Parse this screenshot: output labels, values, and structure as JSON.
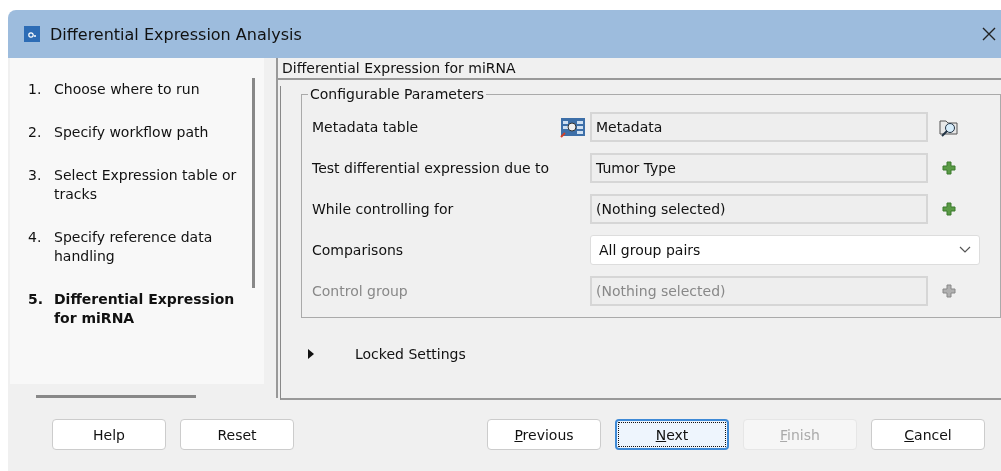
{
  "window": {
    "title": "Differential Expression Analysis"
  },
  "steps": [
    {
      "number": "1.",
      "label": "Choose where to run",
      "selected": false
    },
    {
      "number": "2.",
      "label": "Specify workflow path",
      "selected": false
    },
    {
      "number": "3.",
      "label": "Select Expression table or tracks",
      "selected": false
    },
    {
      "number": "4.",
      "label": "Specify reference data handling",
      "selected": false
    },
    {
      "number": "5.",
      "label": "Differential Expression for miRNA",
      "selected": true
    }
  ],
  "panel": {
    "title": "Differential Expression for miRNA",
    "group_title": "Configurable Parameters",
    "parameters": [
      {
        "kind": "file",
        "label": "Metadata table",
        "value": "Metadata",
        "disabled": false
      },
      {
        "kind": "picker",
        "label": "Test differential expression due to",
        "value": "Tumor Type",
        "disabled": false
      },
      {
        "kind": "picker",
        "label": "While controlling for",
        "value": "(Nothing selected)",
        "disabled": false
      },
      {
        "kind": "dropdown",
        "label": "Comparisons",
        "value": "All group pairs",
        "disabled": false
      },
      {
        "kind": "picker",
        "label": "Control group",
        "value": "(Nothing selected)",
        "disabled": true
      }
    ],
    "locked_settings": {
      "label": "Locked Settings",
      "expanded": false
    }
  },
  "buttons": [
    {
      "label": "Help",
      "mnemonic": false,
      "disabled": false,
      "focused": false
    },
    {
      "label": "Reset",
      "mnemonic": false,
      "disabled": false,
      "focused": false
    },
    {
      "label": "Previous",
      "mnemonic": true,
      "disabled": false,
      "focused": false
    },
    {
      "label": "Next",
      "mnemonic": true,
      "disabled": false,
      "focused": true
    },
    {
      "label": "Finish",
      "mnemonic": true,
      "disabled": true,
      "focused": false
    },
    {
      "label": "Cancel",
      "mnemonic": true,
      "disabled": false,
      "focused": false
    }
  ]
}
